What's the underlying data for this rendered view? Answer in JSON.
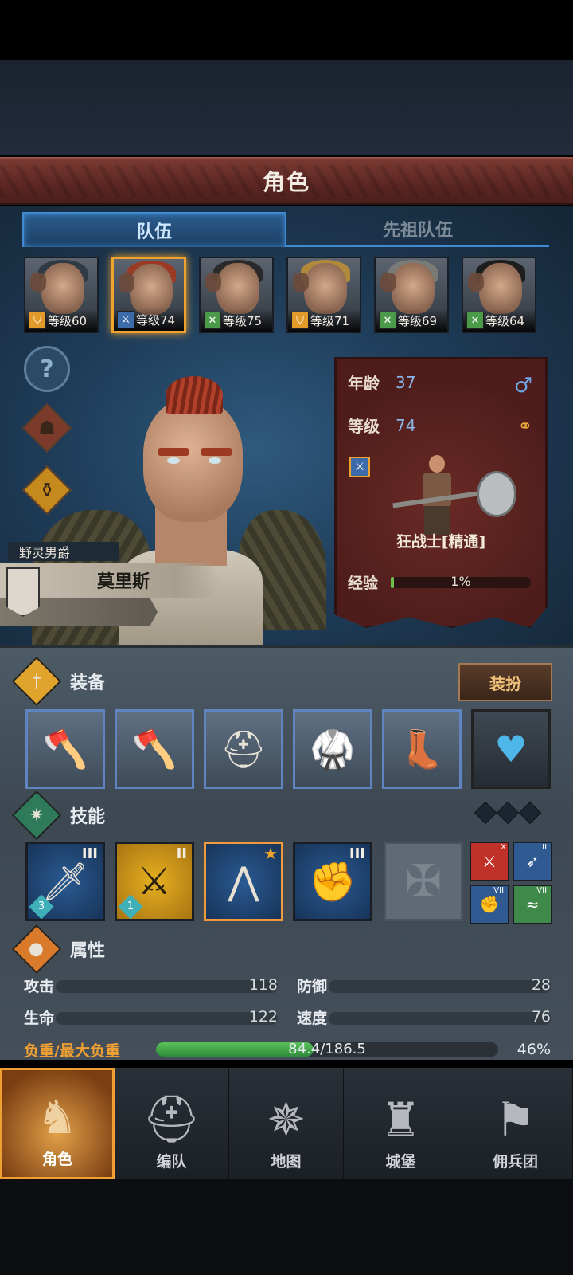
{
  "header": {
    "title": "角色"
  },
  "tabs": {
    "team": "队伍",
    "ancestor_team": "先祖队伍"
  },
  "roster": [
    {
      "level_label": "等级60",
      "class_icon": "shield-icon",
      "class_color": "#e29a2a",
      "hair_color": "#2f3a44"
    },
    {
      "level_label": "等级74",
      "class_icon": "sword-icon",
      "class_color": "#3d6aa8",
      "hair_color": "#9a3a24"
    },
    {
      "level_label": "等级75",
      "class_icon": "crossed-swords-icon",
      "class_color": "#4a9a4a",
      "hair_color": "#2a2a2a"
    },
    {
      "level_label": "等级71",
      "class_icon": "shield-icon",
      "class_color": "#e29a2a",
      "hair_color": "#b08a3a"
    },
    {
      "level_label": "等级69",
      "class_icon": "crossed-swords-icon",
      "class_color": "#4a9a4a",
      "hair_color": "#7a7a76"
    },
    {
      "level_label": "等级64",
      "class_icon": "crossed-swords-icon",
      "class_color": "#4a9a4a",
      "hair_color": "#1e1e1e"
    }
  ],
  "character": {
    "rank": "野灵男爵",
    "name": "莫里斯",
    "age_label": "年龄",
    "age": "37",
    "level_label": "等级",
    "level": "74",
    "class_name": "狂战士[精通]",
    "exp_label": "经验",
    "exp_text": "1%",
    "exp_fraction": 0.01
  },
  "equipment": {
    "title": "装备",
    "outfit_button": "装扮",
    "slots": [
      "axe-icon",
      "axe-icon",
      "helmet-icon",
      "armor-icon",
      "boots-icon",
      "amulet-icon"
    ]
  },
  "skills": {
    "title": "技能",
    "items": [
      {
        "icon": "sword-drop-icon",
        "roman": "III",
        "count": "3"
      },
      {
        "icon": "slash-icon",
        "roman": "II",
        "count": "1"
      },
      {
        "icon": "claw-icon",
        "roman": "",
        "count": ""
      },
      {
        "icon": "sword-fist-icon",
        "roman": "III",
        "count": ""
      }
    ],
    "mini": [
      {
        "roman": "X",
        "color": "#c0312a"
      },
      {
        "roman": "III",
        "color": "#2f5a92"
      },
      {
        "roman": "VIII",
        "color": "#2f5a92"
      },
      {
        "roman": "VIII",
        "color": "#3f8a4a"
      }
    ]
  },
  "attributes": {
    "title": "属性",
    "attack_label": "攻击",
    "attack": "118",
    "defense_label": "防御",
    "defense": "28",
    "hp_label": "生命",
    "hp": "122",
    "speed_label": "速度",
    "speed": "76",
    "load_label": "负重/最大负重",
    "load_text": "84.4/186.5",
    "load_fraction": 0.46,
    "load_pct": "46%"
  },
  "nav": [
    {
      "label": "角色",
      "icon": "knight-icon"
    },
    {
      "label": "编队",
      "icon": "helmet-icon"
    },
    {
      "label": "地图",
      "icon": "compass-icon"
    },
    {
      "label": "城堡",
      "icon": "castle-icon"
    },
    {
      "label": "佣兵团",
      "icon": "banner-icon"
    }
  ]
}
